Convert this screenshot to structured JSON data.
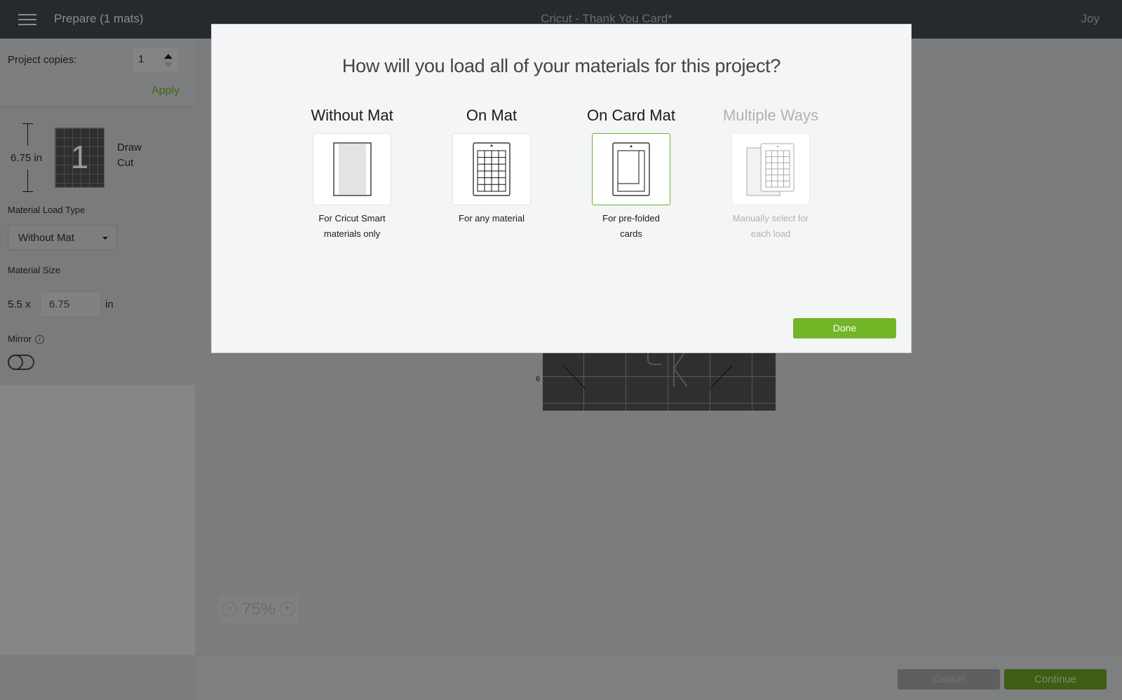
{
  "topbar": {
    "left_title": "Prepare (1 mats)",
    "center_title": "Cricut - Thank You Card*",
    "user": "Joy"
  },
  "sidebar": {
    "copies_label": "Project copies:",
    "copies_value": "1",
    "apply_label": "Apply",
    "mat": {
      "height_label": "6.75 in",
      "number": "1",
      "operations": [
        "Draw",
        "Cut"
      ]
    },
    "load_type_label": "Material Load Type",
    "load_type_value": "Without Mat",
    "size_label": "Material Size",
    "size_width": "5.5 x",
    "size_height_value": "6.75",
    "size_unit": "in",
    "mirror_label": "Mirror",
    "mirror_on": false
  },
  "canvas": {
    "ruler_mark": "6",
    "zoom_level": "75%"
  },
  "footer": {
    "cancel_label": "Cancel",
    "continue_label": "Continue"
  },
  "modal": {
    "title": "How will you load all of your materials for this project?",
    "options": [
      {
        "title": "Without Mat",
        "desc_line1": "For Cricut Smart",
        "desc_line2": "materials only",
        "state": "normal"
      },
      {
        "title": "On Mat",
        "desc_line1": "For any material",
        "desc_line2": "",
        "state": "normal"
      },
      {
        "title": "On Card Mat",
        "desc_line1": "For pre-folded",
        "desc_line2": "cards",
        "state": "selected"
      },
      {
        "title": "Multiple Ways",
        "desc_line1": "Manually select for",
        "desc_line2": "each load",
        "state": "disabled"
      }
    ],
    "done_label": "Done"
  },
  "colors": {
    "accent_green": "#72b526",
    "selected_border": "#6cb52b",
    "topbar_bg": "#262a2e"
  }
}
